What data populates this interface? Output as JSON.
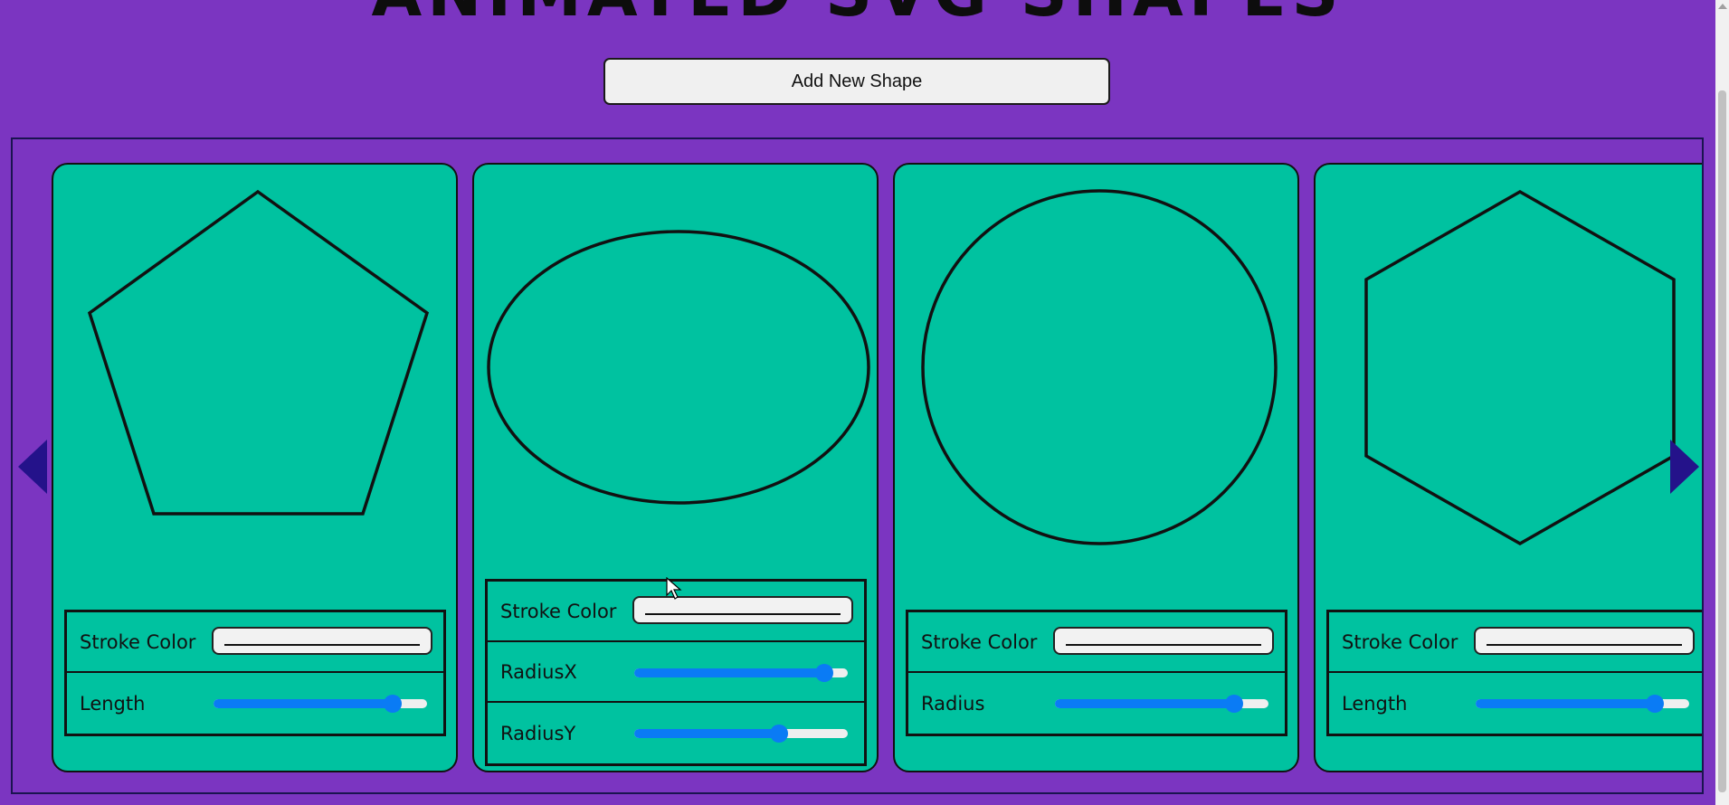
{
  "page": {
    "title": "ANIMATED SVG SHAPES",
    "add_button_label": "Add New Shape"
  },
  "colors": {
    "background": "#7b35c1",
    "card": "#00c2a0",
    "slider": "#0a7bf5",
    "arrow": "#24128a"
  },
  "carousel": {
    "prev_icon": "triangle-left-icon",
    "next_icon": "triangle-right-icon",
    "cards": [
      {
        "shape": "pentagon",
        "controls": [
          {
            "label": "Stroke Color",
            "type": "color"
          },
          {
            "label": "Length",
            "type": "slider",
            "value": 0.84
          }
        ]
      },
      {
        "shape": "ellipse",
        "controls": [
          {
            "label": "Stroke Color",
            "type": "color"
          },
          {
            "label": "RadiusX",
            "type": "slider",
            "value": 0.89
          },
          {
            "label": "RadiusY",
            "type": "slider",
            "value": 0.68
          }
        ]
      },
      {
        "shape": "circle",
        "controls": [
          {
            "label": "Stroke Color",
            "type": "color"
          },
          {
            "label": "Radius",
            "type": "slider",
            "value": 0.84
          }
        ]
      },
      {
        "shape": "hexagon",
        "controls": [
          {
            "label": "Stroke Color",
            "type": "color"
          },
          {
            "label": "Length",
            "type": "slider",
            "value": 0.84
          }
        ]
      }
    ]
  }
}
